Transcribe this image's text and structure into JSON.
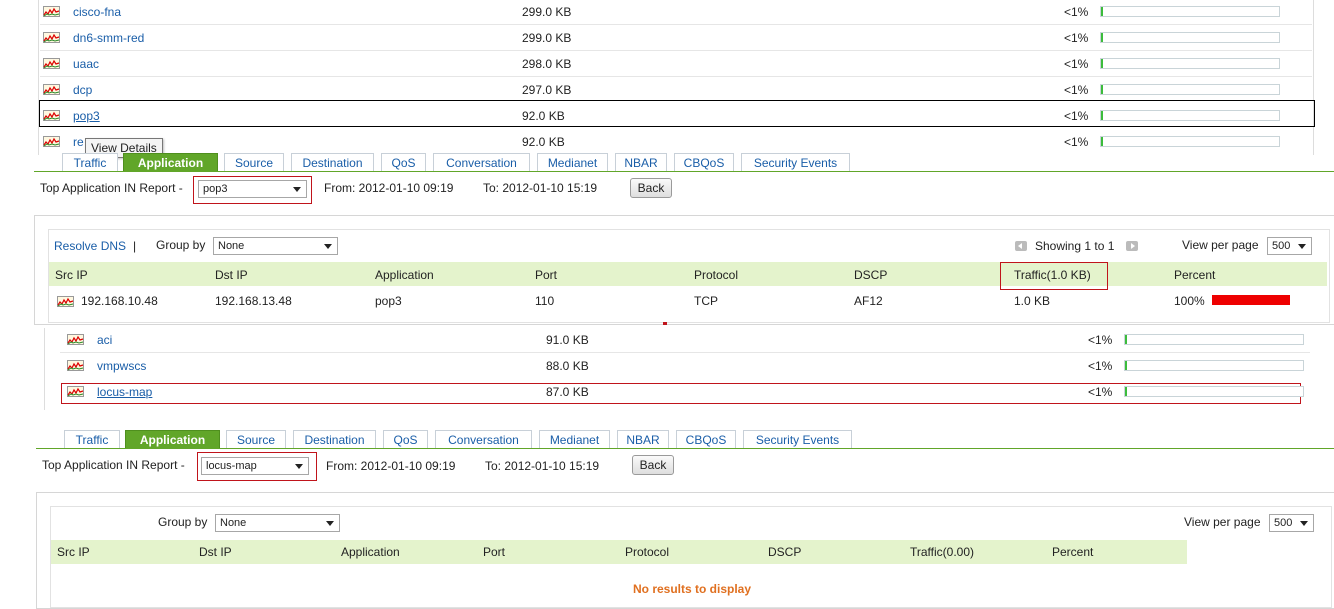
{
  "colors": {
    "accent_green": "#61a629",
    "header_green": "#e4f3cc",
    "link_blue": "#1a5ea8",
    "highlight_red": "#c0141b",
    "percent_bar_red": "#ee0000",
    "no_results_orange": "#e07020"
  },
  "top_list": {
    "rows": [
      {
        "name": "cisco-fna",
        "traffic": "299.0 KB",
        "percent": "<1%",
        "bar_fraction": 0.01
      },
      {
        "name": "dn6-smm-red",
        "traffic": "299.0 KB",
        "percent": "<1%",
        "bar_fraction": 0.01
      },
      {
        "name": "uaac",
        "traffic": "298.0 KB",
        "percent": "<1%",
        "bar_fraction": 0.01
      },
      {
        "name": "dcp",
        "traffic": "297.0 KB",
        "percent": "<1%",
        "bar_fraction": 0.01
      },
      {
        "name": "pop3",
        "traffic": "92.0 KB",
        "percent": "<1%",
        "bar_fraction": 0.01
      },
      {
        "name": "re",
        "traffic": "92.0 KB",
        "percent": "<1%",
        "bar_fraction": 0.01
      }
    ],
    "tooltip": "View Details"
  },
  "tabs": [
    "Traffic",
    "Application",
    "Source",
    "Destination",
    "QoS",
    "Conversation",
    "Medianet",
    "NBAR",
    "CBQoS",
    "Security Events"
  ],
  "active_tab": "Application",
  "report1": {
    "report_label": "Top Application IN Report -",
    "selected_app": "pop3",
    "from": "From: 2012-01-10 09:19",
    "to": "To: 2012-01-10 15:19",
    "back": "Back",
    "resolve_dns": "Resolve DNS",
    "separator": "|",
    "group_by_label": "Group by",
    "group_by_value": "None",
    "showing": "Showing 1 to 1",
    "view_per_page_label": "View per page",
    "view_per_page_value": "500",
    "columns": [
      "Src IP",
      "Dst IP",
      "Application",
      "Port",
      "Protocol",
      "DSCP",
      "Traffic(1.0 KB)",
      "Percent"
    ],
    "row": {
      "src_ip": "192.168.10.48",
      "dst_ip": "192.168.13.48",
      "application": "pop3",
      "port": "110",
      "protocol": "TCP",
      "dscp": "AF12",
      "traffic": "1.0 KB",
      "percent": "100%",
      "percent_fraction": 1.0
    }
  },
  "middle_list": {
    "rows": [
      {
        "name": "aci",
        "traffic": "91.0 KB",
        "percent": "<1%",
        "bar_fraction": 0.01
      },
      {
        "name": "vmpwscs",
        "traffic": "88.0 KB",
        "percent": "<1%",
        "bar_fraction": 0.01
      },
      {
        "name": "locus-map",
        "traffic": "87.0 KB",
        "percent": "<1%",
        "bar_fraction": 0.01
      }
    ]
  },
  "report2": {
    "report_label": "Top Application IN Report -",
    "selected_app": "locus-map",
    "from": "From: 2012-01-10 09:19",
    "to": "To: 2012-01-10 15:19",
    "back": "Back",
    "group_by_label": "Group by",
    "group_by_value": "None",
    "view_per_page_label": "View per page",
    "view_per_page_value": "500",
    "columns": [
      "Src IP",
      "Dst IP",
      "Application",
      "Port",
      "Protocol",
      "DSCP",
      "Traffic(0.00)",
      "Percent"
    ],
    "empty_message": "No results to display"
  }
}
